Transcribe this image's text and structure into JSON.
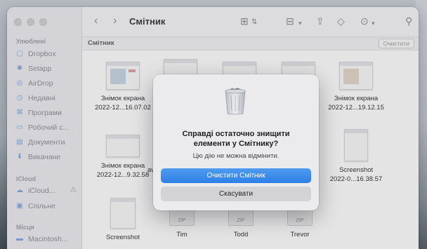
{
  "window": {
    "title": "Смітник"
  },
  "sidebar": {
    "favorites_header": "Улюблені",
    "favorites": [
      {
        "label": "Dropbox",
        "icon": "dropbox-icon"
      },
      {
        "label": "Setapp",
        "icon": "setapp-icon"
      },
      {
        "label": "AirDrop",
        "icon": "airdrop-icon"
      },
      {
        "label": "Недавні",
        "icon": "clock-icon"
      },
      {
        "label": "Програми",
        "icon": "applications-icon"
      },
      {
        "label": "Робочий с...",
        "icon": "desktop-icon"
      },
      {
        "label": "Документи",
        "icon": "document-icon"
      },
      {
        "label": "Викачане",
        "icon": "download-icon"
      }
    ],
    "icloud_header": "iCloud",
    "icloud": [
      {
        "label": "iCloud...",
        "icon": "icloud-icon"
      },
      {
        "label": "Спільне",
        "icon": "shared-folder-icon"
      }
    ],
    "locations_header": "Місця",
    "locations": [
      {
        "label": "Macintosh...",
        "icon": "disk-icon"
      }
    ]
  },
  "pathbar": {
    "label": "Смітник",
    "empty_button": "Очистити"
  },
  "files": [
    {
      "line1": "Знімок екрана",
      "line2": "2022-12...16.07.02"
    },
    {
      "line1": "Знімок екрана",
      "line2": "2022-12...19.12.15"
    },
    {
      "line1": "Знімок екрана",
      "line2": "2022-12...9.32.58"
    },
    {
      "line1": "Screenshot",
      "line2": "2022-0...16.38.57"
    },
    {
      "line1": "Screenshot",
      "line2": ""
    },
    {
      "line1": "Tim",
      "line2": ""
    },
    {
      "line1": "Todd",
      "line2": ""
    },
    {
      "line1": "Trevor",
      "line2": ""
    }
  ],
  "partial_label": "av",
  "zip_label": "ZIP",
  "dialog": {
    "title": "Справді остаточно знищити елементи у Смітнику?",
    "message": "Цю дію не можна відмінити.",
    "confirm_button": "Очистити Смітник",
    "cancel_button": "Скасувати"
  },
  "colors": {
    "accent": "#3d8de8",
    "sidebar": "#ecebf0",
    "dialog": "#ebebed"
  }
}
